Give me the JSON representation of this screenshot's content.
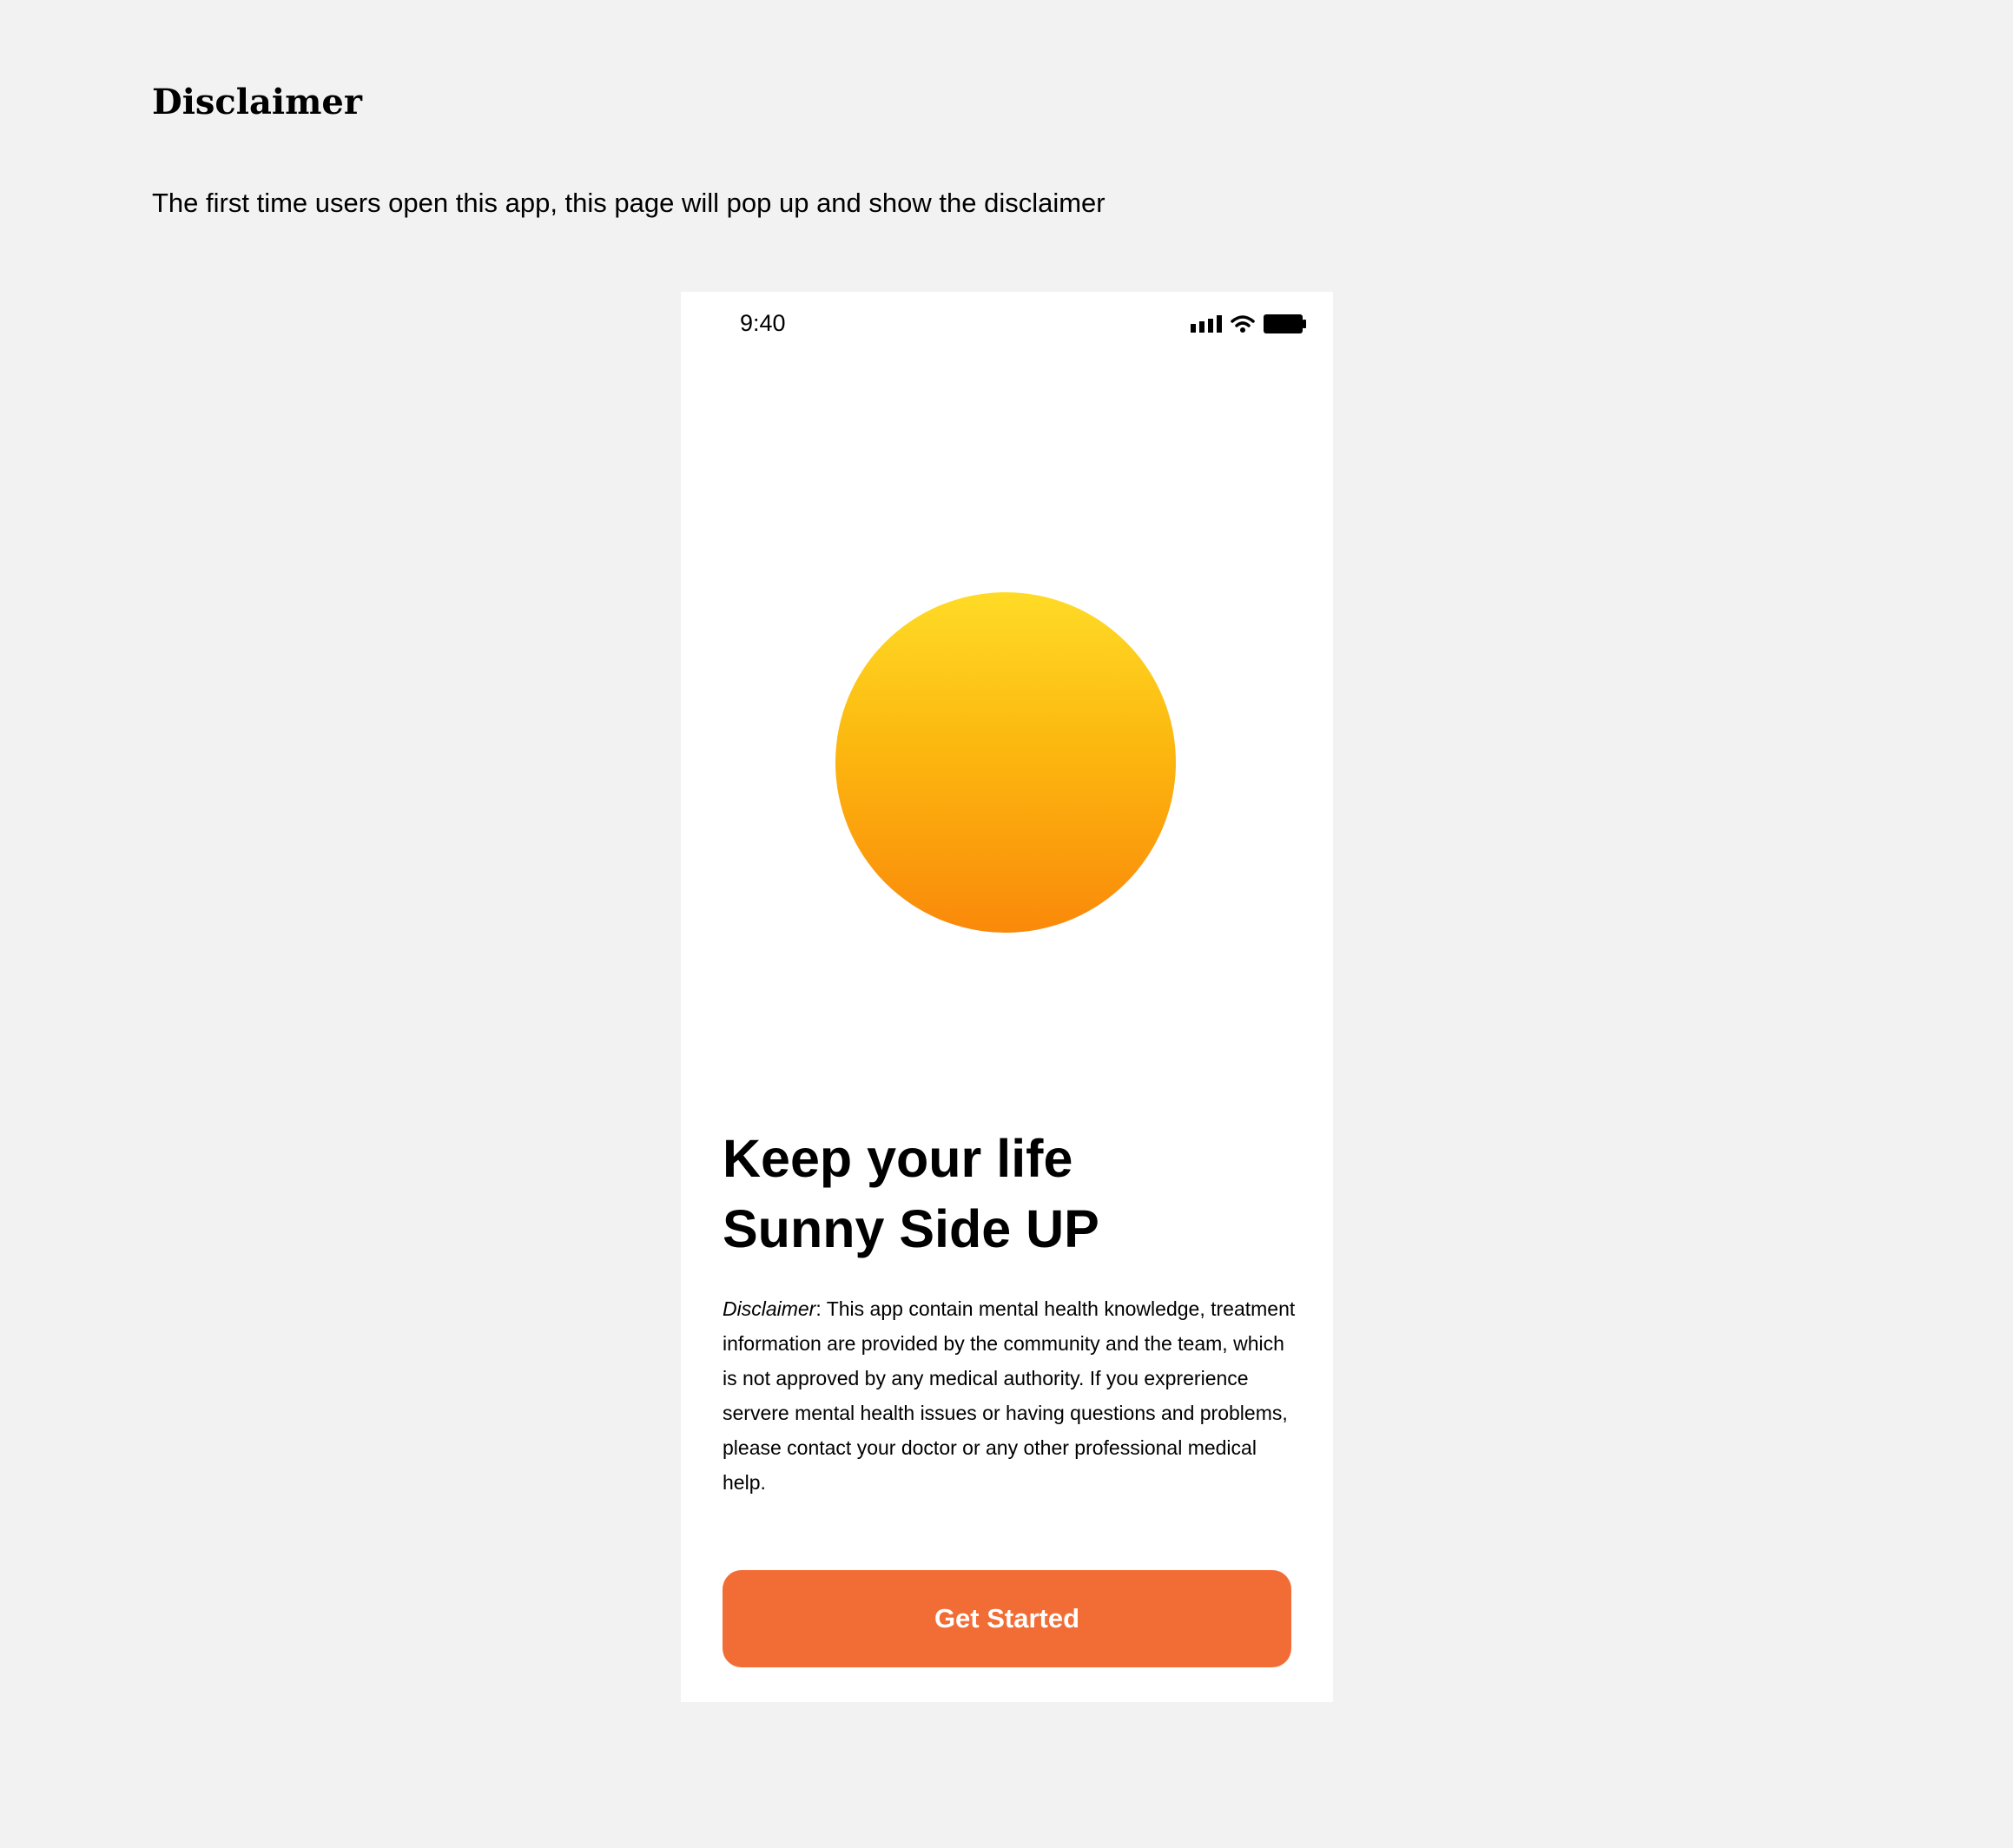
{
  "page": {
    "heading": "Disclaimer",
    "subtext": "The first time users open this app, this page will pop up and show the disclaimer"
  },
  "phone": {
    "status_bar": {
      "time": "9:40",
      "icons": [
        "signal-icon",
        "wifi-icon",
        "battery-icon"
      ]
    },
    "hero": {
      "graphic": "sun-circle",
      "gradient_colors": [
        "#ffdb26",
        "#fcb80f",
        "#fa890a"
      ]
    },
    "headline": {
      "line1": "Keep your life",
      "line2": "Sunny Side UP"
    },
    "disclaimer": {
      "label": "Disclaimer",
      "body": ": This app contain mental health knowledge, treatment information are provided by the community and the team, which is not approved by any medical authority. If you exprerience servere mental health issues or having questions and problems, please contact your doctor or any other professional medical help."
    },
    "button": {
      "label": "Get Started",
      "color": "#f26d35"
    }
  }
}
